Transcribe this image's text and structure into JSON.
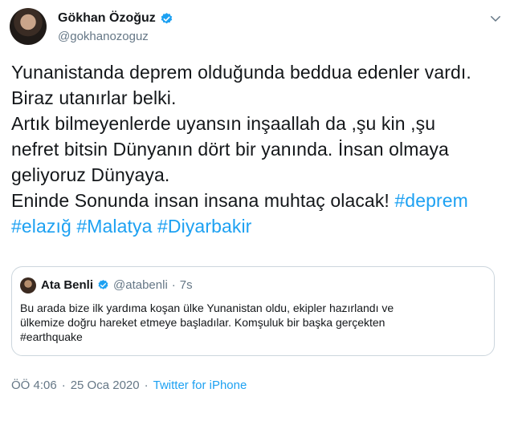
{
  "author": {
    "name": "Gökhan Özoğuz",
    "handle": "@gokhanozoguz"
  },
  "tweet": {
    "lines": [
      {
        "text": "Yunanistanda deprem olduğunda beddua edenler vardı.",
        "hashtags": []
      },
      {
        "text": "Biraz utanırlar belki.",
        "hashtags": []
      },
      {
        "text": "Artık bilmeyenlerde uyansın inşaallah da ,şu kin ,şu",
        "hashtags": []
      },
      {
        "text": "nefret bitsin Dünyanın dört bir yanında. İnsan olmaya",
        "hashtags": []
      },
      {
        "text": "geliyoruz Dünyaya.",
        "hashtags": []
      },
      {
        "text": "Eninde Sonunda insan insana muhtaç olacak! ",
        "hashtags": [
          "#deprem"
        ]
      },
      {
        "text": "",
        "hashtags": [
          "#elazığ",
          "#Malatya",
          "#Diyarbakir"
        ]
      }
    ]
  },
  "quote": {
    "name": "Ata Benli",
    "handle": "@atabenli",
    "separator": "·",
    "time": "7s",
    "lines": [
      "Bu arada bize ilk yardıma koşan ülke Yunanistan oldu, ekipler hazırlandı ve",
      "ülkemize doğru hareket etmeye başladılar. Komşuluk bir başka gerçekten",
      "#earthquake"
    ]
  },
  "footer": {
    "time": "ÖÖ 4:06",
    "separator1": "·",
    "date": "25 Oca 2020",
    "separator2": "·",
    "source": "Twitter for iPhone"
  },
  "colors": {
    "link": "#1da1f2",
    "muted": "#657786",
    "border": "#ccd6dd",
    "verified": "#1da1f2"
  },
  "icons": [
    "verified-badge-icon",
    "chevron-down-icon"
  ]
}
